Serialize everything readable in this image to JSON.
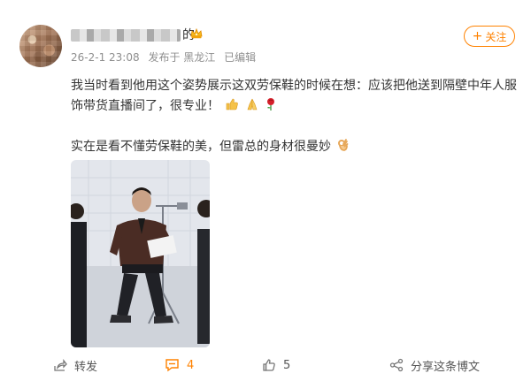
{
  "post": {
    "author_name_suffix": "的",
    "meta": {
      "date": "26-2-1 23:08",
      "source": "发布于 黑龙江",
      "edited": "已编辑"
    },
    "follow_label": "关注",
    "text_line1": "我当时看到他用这个姿势展示这双劳保鞋的时候在想：应该把他送到隔壁中年人服",
    "text_line2": "饰带货直播间了，很专业！",
    "text_line3": "实在是看不懂劳保鞋的美，但雷总的身材很曼妙"
  },
  "actions": {
    "forward": {
      "label": "转发"
    },
    "comment": {
      "count": "4"
    },
    "like": {
      "count": "5"
    },
    "share": {
      "label": "分享这条博文"
    }
  },
  "colors": {
    "accent": "#ff8200",
    "meta_text": "#8f8f8f",
    "body_text": "#333333"
  }
}
